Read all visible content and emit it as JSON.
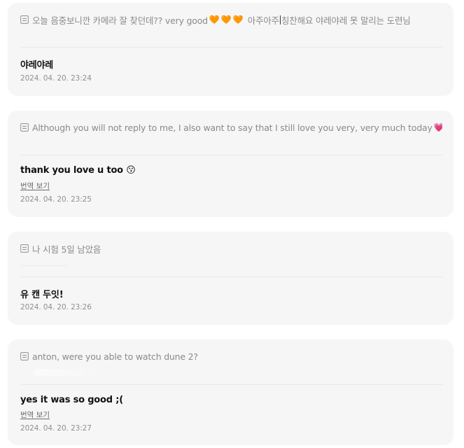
{
  "messages": [
    {
      "question": {
        "icon": "memo-icon",
        "text_before_caret": "오늘 음중보니깐 카메라 잘 찾던데?? very good",
        "emoji": [
          "🧡",
          "🧡",
          "🧡"
        ],
        "text_after_emoji": "아주아주",
        "text_after_caret": "칭찬해요 야레야레 못 말리는 도련님"
      },
      "answer": "야레야레",
      "translate_label": null,
      "timestamp": "2024. 04. 20. 23:24"
    },
    {
      "question": {
        "icon": "memo-icon",
        "text": "Although you will not reply to me, I also want to say that I still love you very, very much today",
        "emoji": [
          "💗",
          "💗",
          "💗"
        ]
      },
      "answer": "thank you love u too 😗",
      "translate_label": "번역 보기",
      "timestamp": "2024. 04. 20. 23:25"
    },
    {
      "question": {
        "icon": "memo-icon",
        "text": "나 시험 5일 남았음"
      },
      "answer": "유 캔 두잇!",
      "translate_label": null,
      "timestamp": "2024. 04. 20. 23:26"
    },
    {
      "question": {
        "icon": "memo-icon",
        "text": "anton, were you able to watch dune 2?"
      },
      "answer": "yes it was so good ;(",
      "translate_label": "번역 보기",
      "timestamp": "2024. 04. 20. 23:27"
    }
  ],
  "colors": {
    "card_background": "#f6f6f7",
    "question_text": "#8a8a8f",
    "answer_text": "#111111",
    "timestamp_text": "#8f8f94",
    "orange_heart": "#f26b1d",
    "pink_heart": "#f542b0"
  }
}
